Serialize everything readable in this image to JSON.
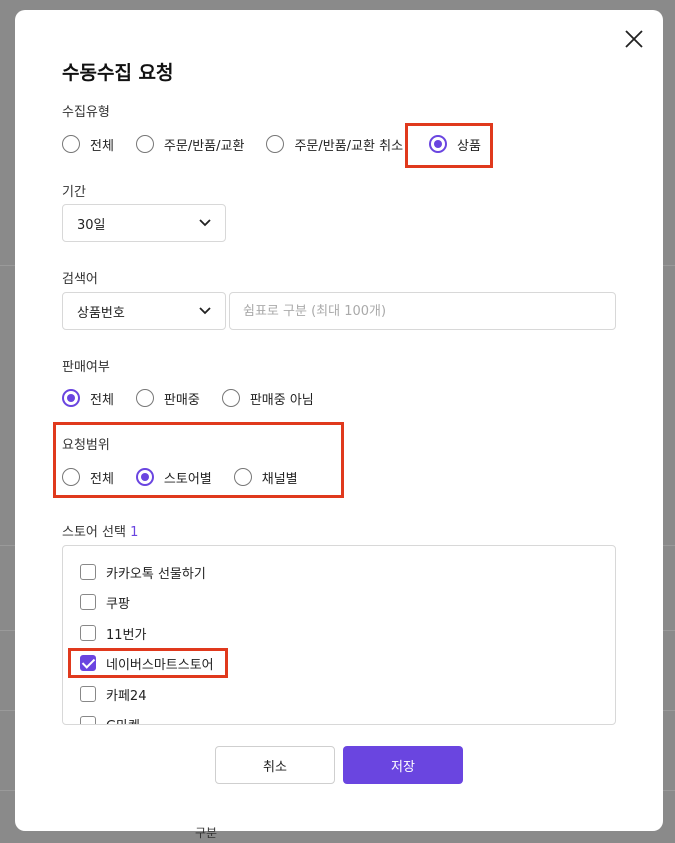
{
  "modal": {
    "title": "수동수집 요청",
    "collect_type": {
      "label": "수집유형",
      "options": [
        "전체",
        "주문/반품/교환",
        "주문/반품/교환 취소",
        "상품"
      ],
      "selected": "상품"
    },
    "period": {
      "label": "기간",
      "value": "30일"
    },
    "search": {
      "label": "검색어",
      "type_value": "상품번호",
      "placeholder": "쉼표로 구분 (최대 100개)"
    },
    "sale_status": {
      "label": "판매여부",
      "options": [
        "전체",
        "판매중",
        "판매중 아님"
      ],
      "selected": "전체"
    },
    "request_scope": {
      "label": "요청범위",
      "options": [
        "전체",
        "스토어별",
        "채널별"
      ],
      "selected": "스토어별"
    },
    "store_select": {
      "label": "스토어 선택",
      "count": "1",
      "stores": [
        {
          "name": "카카오톡 선물하기",
          "checked": false
        },
        {
          "name": "쿠팡",
          "checked": false
        },
        {
          "name": "11번가",
          "checked": false
        },
        {
          "name": "네이버스마트스토어",
          "checked": true
        },
        {
          "name": "카페24",
          "checked": false
        },
        {
          "name": "G마켓",
          "checked": false
        }
      ]
    },
    "buttons": {
      "cancel": "취소",
      "save": "저장"
    }
  },
  "colors": {
    "accent": "#6a45e0",
    "highlight": "#e0391d"
  },
  "icons": {
    "close": "close-icon",
    "dropdown": "chevron-down-icon"
  }
}
